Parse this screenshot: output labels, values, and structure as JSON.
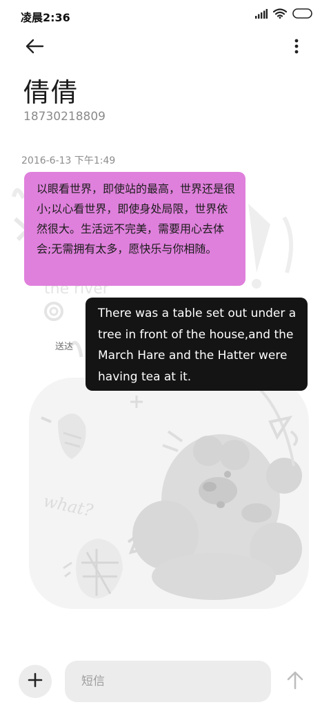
{
  "status_bar": {
    "time": "凌晨2:36",
    "icons": [
      "signal-icon",
      "wifi-icon",
      "battery-icon"
    ]
  },
  "header": {
    "back_icon": "arrow-left-icon",
    "more_icon": "more-vertical-icon"
  },
  "contact": {
    "name": "倩倩",
    "number": "18730218809"
  },
  "conversation": {
    "timestamp": "2016-6-13 下午1:49",
    "messages": [
      {
        "direction": "received",
        "text": "以眼看世界，即使站的最高，世界还是很小;以心看世界，即使身处局限，世界依然很大。生活远不完美，需要用心去体会;无需拥有太多，愿快乐与你相随。",
        "color": "#df80dc"
      },
      {
        "direction": "sent",
        "text": "There was a table set out under a tree in front of the house,and the March Hare and the Hatter were having tea at it.",
        "status": "送达",
        "color": "#141414"
      }
    ]
  },
  "composer": {
    "add_icon": "plus-icon",
    "placeholder": "短信",
    "value": "",
    "send_icon": "arrow-up-icon"
  },
  "colors": {
    "received_bubble": "#df80dc",
    "sent_bubble": "#141414",
    "input_background": "#ececec"
  }
}
